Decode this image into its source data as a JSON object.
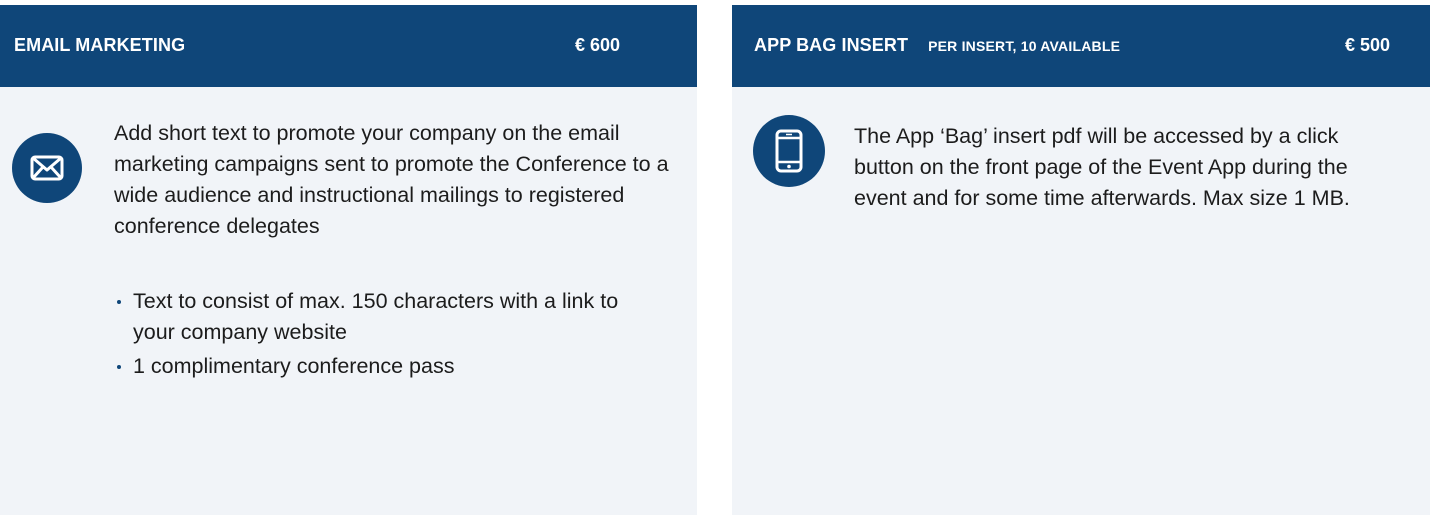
{
  "cards": [
    {
      "title": "EMAIL MARKETING",
      "price": "€ 600",
      "icon": "envelope-icon",
      "description": "Add short text to promote your company on the email marketing campaigns sent to promote the Conference to a wide audience and instructional mailings to registered conference delegates",
      "bullets": [
        "Text to consist of max. 150 characters with a link to your company website",
        "1 complimentary conference pass"
      ]
    },
    {
      "title": "APP BAG INSERT",
      "subtitle": "PER INSERT, 10 AVAILABLE",
      "price": "€ 500",
      "icon": "smartphone-icon",
      "description": "The App ‘Bag’ insert pdf will be accessed by a click button on the front page of the Event App during the event and for some time afterwards. Max size 1 MB."
    }
  ],
  "colors": {
    "header_bg": "#0f4679",
    "card_bg": "#f1f4f8",
    "text": "#1c1c1c"
  }
}
